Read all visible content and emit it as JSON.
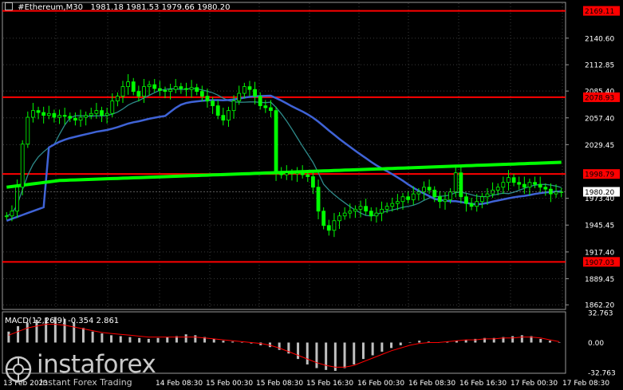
{
  "window": {
    "symbol_title": "#Ethereum,M30",
    "ohlc": "1981.18 1981.53 1979.66 1980.20"
  },
  "price_axis": {
    "ticks": [
      "2140.60",
      "2112.85",
      "2085.40",
      "2057.40",
      "2029.45",
      "1973.40",
      "1945.45",
      "1917.40",
      "1889.45",
      "1862.20"
    ],
    "current_price": "1980.20",
    "levels": [
      {
        "label": "2169.11",
        "value": 2169.11
      },
      {
        "label": "2078.93",
        "value": 2078.93
      },
      {
        "label": "1998.79",
        "value": 1998.79
      },
      {
        "label": "1907.03",
        "value": 1907.03
      }
    ],
    "level_color": "#ff0000"
  },
  "time_axis": {
    "ticks": [
      "13 Feb 2023",
      "14 Feb 08:30",
      "15 Feb 00:30",
      "15 Feb 08:30",
      "15 Feb 16:30",
      "16 Feb 00:30",
      "16 Feb 08:30",
      "16 Feb 16:30",
      "17 Feb 00:30",
      "17 Feb 08:30"
    ]
  },
  "indicator": {
    "label": "MACD(12,26,9) -0.354 2.861",
    "ticks": [
      "32.763",
      "0.00",
      "-32.763"
    ]
  },
  "watermark": {
    "brand": "instaforex",
    "tagline": "Instant Forex Trading"
  },
  "colors": {
    "background": "#000000",
    "candle": "#00ff00",
    "ma_fast": "#2e8b8b",
    "ma_mid": "#3f63d6",
    "ma_slow": "#00ff00",
    "macd_hist": "#c0c0c0",
    "macd_signal": "#ff0000",
    "axis_text": "#ffffff"
  },
  "chart_data": {
    "type": "candlestick",
    "price_ylim": [
      1862.2,
      2169.11
    ],
    "series": [
      {
        "name": "price",
        "values": [
          1955,
          1960,
          1985,
          2030,
          2058,
          2065,
          2063,
          2060,
          2062,
          2058,
          2060,
          2059,
          2057,
          2055,
          2058,
          2060,
          2062,
          2065,
          2060,
          2062,
          2075,
          2080,
          2090,
          2095,
          2085,
          2080,
          2090,
          2092,
          2088,
          2086,
          2085,
          2087,
          2090,
          2088,
          2087,
          2089,
          2085,
          2080,
          2075,
          2070,
          2060,
          2055,
          2065,
          2075,
          2083,
          2090,
          2087,
          2080,
          2070,
          2068,
          2065,
          2000,
          1998,
          2000,
          1999,
          2000,
          1998,
          1996,
          1985,
          1960,
          1945,
          1940,
          1950,
          1955,
          1958,
          1960,
          1962,
          1965,
          1960,
          1955,
          1958,
          1962,
          1965,
          1968,
          1970,
          1975,
          1972,
          1978,
          1980,
          1985,
          1982,
          1975,
          1970,
          1972,
          1980,
          2000,
          1975,
          1968,
          1965,
          1970,
          1975,
          1978,
          1982,
          1985,
          1990,
          1995,
          1990,
          1988,
          1985,
          1990,
          1988,
          1985,
          1983,
          1978,
          1980,
          1980.2
        ]
      }
    ],
    "macd": {
      "ylim": [
        -32.763,
        32.763
      ],
      "hist": [
        12,
        18,
        22,
        25,
        27,
        28,
        26,
        22,
        16,
        12,
        10,
        8,
        7,
        6,
        5,
        4,
        5,
        6,
        7,
        9,
        8,
        6,
        4,
        2,
        1,
        0,
        -1,
        -3,
        -5,
        -8,
        -12,
        -18,
        -24,
        -28,
        -30,
        -31,
        -28,
        -24,
        -18,
        -14,
        -10,
        -6,
        -3,
        0,
        2,
        1,
        0,
        1,
        2,
        3,
        4,
        5,
        5,
        6,
        7,
        8,
        7,
        4,
        2,
        0
      ],
      "signal": [
        8,
        12,
        16,
        18,
        20,
        20,
        19,
        17,
        15,
        13,
        11,
        10,
        9,
        8,
        7,
        6,
        6,
        6,
        6,
        6,
        6,
        5,
        4,
        3,
        2,
        1,
        0,
        -1,
        -3,
        -6,
        -10,
        -14,
        -18,
        -22,
        -25,
        -27,
        -27,
        -25,
        -21,
        -17,
        -13,
        -9,
        -6,
        -3,
        -1,
        0,
        0,
        1,
        2,
        3,
        3,
        4,
        4,
        5,
        5,
        6,
        6,
        5,
        3,
        1
      ]
    }
  }
}
